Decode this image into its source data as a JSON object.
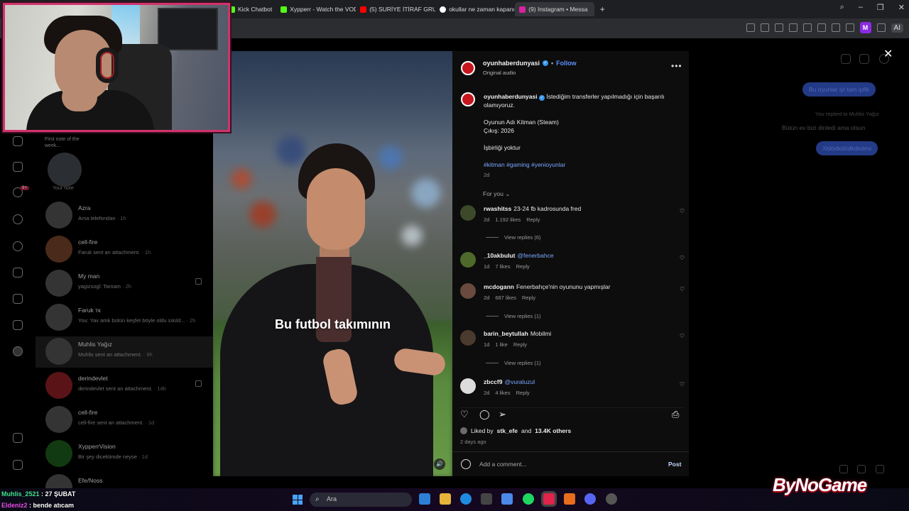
{
  "browser": {
    "tabs": [
      {
        "label": "Kick Chatbot",
        "color": "#53fc18"
      },
      {
        "label": "Xypperr - Watch the VOD",
        "color": "#53fc18"
      },
      {
        "label": "(5) SURİYE İTİRAF GRUPLA",
        "color": "#ff0000"
      },
      {
        "label": "okullar ne zaman kapanıy",
        "color": "#ffffff"
      },
      {
        "label": "(9) Instagram • Messa",
        "color": "#d6249f",
        "active": true
      }
    ],
    "new_tab": "+",
    "profile_initial": "M",
    "ai_label": "AI"
  },
  "inbox": {
    "note_text": "First note of the week...",
    "your_note_label": "Your note",
    "conversations": [
      {
        "name": "Azra",
        "preview": "Ama telefondan",
        "time": "· 1h"
      },
      {
        "name": "cell-fire",
        "preview": "Faruk sent an attachment.",
        "time": "· 1h"
      },
      {
        "name": "My man",
        "preview": "yagizsogl: Tamam",
        "time": "· 2h"
      },
      {
        "name": "Faruk тк",
        "preview": "You: Yav amk bütün keşfet böyle oldu sıkıld...",
        "time": "· 2h"
      },
      {
        "name": "Muhlis Yağız",
        "preview": "Muhlis sent an attachment.",
        "time": "· 9h"
      },
      {
        "name": "derindevlet",
        "preview": "derindevlet sent an attachment.",
        "time": "· 14h"
      },
      {
        "name": "cell-fire",
        "preview": "cell-fire sent an attachment.",
        "time": "· 1d"
      },
      {
        "name": "XypperrVision",
        "preview": "Bir şey dicektimde neyse",
        "time": "· 1d"
      },
      {
        "name": "Efe/Noss",
        "preview": "",
        "time": ""
      }
    ],
    "badge": "9+"
  },
  "chat": {
    "bubble1": "Bu oyunlar iyi tam ipfik",
    "replied_note": "You replied to Muhlis Yağız",
    "replied_text": "Bütün ev bizi dinledi ama olsun",
    "bubble2": "Xldödkdödkdkdmx"
  },
  "reel": {
    "caption_overlay": "Bu futbol takımının",
    "username": "oyunhaberdunyasi",
    "follow_label": "Follow",
    "audio_label": "Original audio",
    "caption_line1": "İstediğim transferler yapılmadığı için başarılı olamıyoruz.",
    "caption_game": "Oyunun Adı Kitman (Steam)",
    "caption_date": "Çıkış: 2026",
    "caption_collab": "İşbirliği yoktur",
    "caption_tags": "#kitman #gaming #yenioyunlar",
    "caption_time": "2d",
    "for_you": "For you",
    "comments": [
      {
        "user": "rwashitss",
        "text": "23-24 fb kadrosunda fred",
        "mention": "",
        "time": "2d",
        "likes": "1.192 likes",
        "reply": "Reply",
        "view_replies": "View replies (6)"
      },
      {
        "user": "_10akbulut",
        "text": "",
        "mention": "@fenerbahce",
        "time": "1d",
        "likes": "7 likes",
        "reply": "Reply",
        "view_replies": ""
      },
      {
        "user": "mcdogann",
        "text": "Fenerbahçe'nin oyununu yapmışlar",
        "mention": "",
        "time": "2d",
        "likes": "687 likes",
        "reply": "Reply",
        "view_replies": "View replies (1)"
      },
      {
        "user": "barin_beytullah",
        "text": "Mobilmi",
        "mention": "",
        "time": "1d",
        "likes": "1 like",
        "reply": "Reply",
        "view_replies": "View replies (1)"
      },
      {
        "user": "zbccf9",
        "text": "",
        "mention": "@vuraluzul",
        "time": "2d",
        "likes": "4 likes",
        "reply": "Reply",
        "view_replies": ""
      }
    ],
    "liked_by_prefix": "Liked by",
    "liked_by_user": "stk_efe",
    "liked_by_and": "and",
    "liked_by_others": "13.4K others",
    "posted_ago": "2 days ago",
    "add_comment_placeholder": "Add a comment...",
    "post_label": "Post"
  },
  "stream": {
    "chat": [
      {
        "user": "Muhlis_2521",
        "text": ": 27 ŞUBAT"
      },
      {
        "user": "Eldeniz2",
        "text": ": bende atıcam"
      }
    ],
    "brand": "ByNoGame"
  },
  "taskbar": {
    "search_placeholder": "Ara"
  }
}
